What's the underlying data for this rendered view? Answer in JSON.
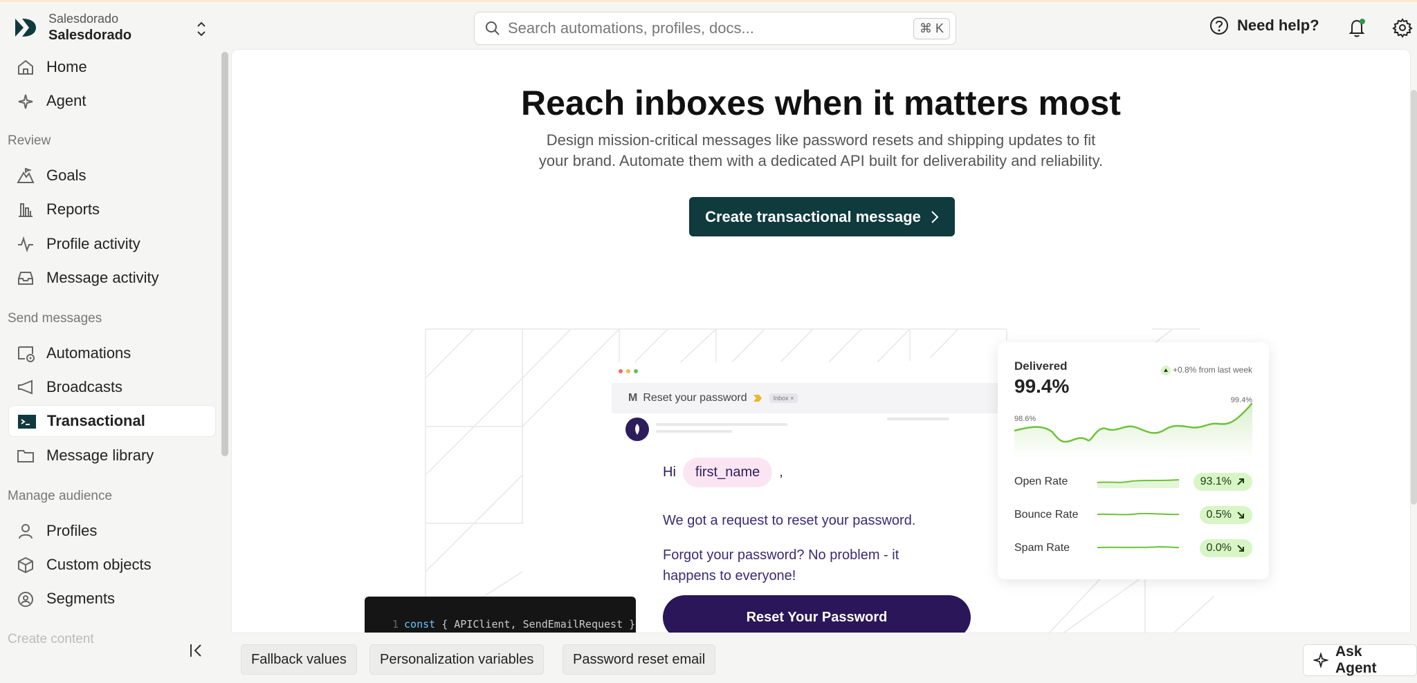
{
  "org": {
    "workspace_label": "Salesdorado",
    "account_name": "Salesdorado"
  },
  "search": {
    "placeholder": "Search automations, profiles, docs...",
    "shortcut": "⌘ K"
  },
  "header": {
    "help_label": "Need help?"
  },
  "sidebar": {
    "items_top": [
      {
        "label": "Home",
        "icon": "home-icon"
      },
      {
        "label": "Agent",
        "icon": "sparkle-icon"
      }
    ],
    "sections": [
      {
        "title": "Review",
        "items": [
          {
            "label": "Goals",
            "icon": "goal-icon"
          },
          {
            "label": "Reports",
            "icon": "bar-chart-icon"
          },
          {
            "label": "Profile activity",
            "icon": "activity-icon"
          },
          {
            "label": "Message activity",
            "icon": "inbox-icon"
          }
        ]
      },
      {
        "title": "Send messages",
        "items": [
          {
            "label": "Automations",
            "icon": "automation-icon"
          },
          {
            "label": "Broadcasts",
            "icon": "megaphone-icon"
          },
          {
            "label": "Transactional",
            "icon": "terminal-icon",
            "active": true
          },
          {
            "label": "Message library",
            "icon": "folder-icon"
          }
        ]
      },
      {
        "title": "Manage audience",
        "items": [
          {
            "label": "Profiles",
            "icon": "user-icon"
          },
          {
            "label": "Custom objects",
            "icon": "cube-icon"
          },
          {
            "label": "Segments",
            "icon": "segment-icon"
          }
        ]
      },
      {
        "title": "Create content",
        "items": []
      }
    ]
  },
  "hero": {
    "title": "Reach inboxes when it matters most",
    "subtitle_line1": "Design mission-critical messages like password resets and shipping updates to fit",
    "subtitle_line2": "your brand. Automate them with a dedicated API built for deliverability and reliability.",
    "cta_label": "Create transactional message"
  },
  "email_preview": {
    "sender_mark": "M",
    "subject": "Reset your password",
    "tag": "Inbox ×",
    "greeting": "Hi",
    "name_token": "first_name",
    "greeting_end": ",",
    "line1": "We got a request to reset your password.",
    "line2a": "Forgot your password? No problem - it",
    "line2b": "happens to everyone!",
    "button_label": "Reset Your Password"
  },
  "code_snippet": {
    "line_number": "1",
    "keyword": "const",
    "rest": " { APIClient, SendEmailRequest }"
  },
  "stats_card": {
    "label": "Delivered",
    "value": "99.4%",
    "change": "+0.8% from last week",
    "max_label": "99.4%",
    "min_label": "98.6%",
    "rates": [
      {
        "name": "Open Rate",
        "value": "93.1%",
        "trend": "up"
      },
      {
        "name": "Bounce Rate",
        "value": "0.5%",
        "trend": "down"
      },
      {
        "name": "Spam Rate",
        "value": "0.0%",
        "trend": "down"
      }
    ],
    "accent": "#6cc23a"
  },
  "bottom": {
    "chips": [
      "Fallback values",
      "Personalization variables",
      "Password reset email"
    ],
    "ask_agent_label": "Ask Agent"
  },
  "colors": {
    "cta_bg": "#0f3a3e",
    "reset_button": "#2a1658",
    "active_item_bg": "#ffffff"
  }
}
